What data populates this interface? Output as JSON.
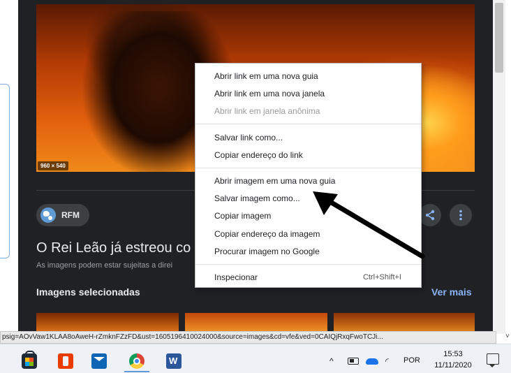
{
  "image_panel": {
    "dimensions_badge": "960 × 540",
    "source_label": "RFM",
    "share_icon": "share-icon",
    "more_icon": "more-vert-icon",
    "result_title": "O Rei Leão já estreou co",
    "result_subtitle": "As imagens podem estar sujeitas a direi",
    "related_section_title": "Imagens selecionadas",
    "see_more_label": "Ver mais"
  },
  "context_menu": {
    "open_link_new_tab": "Abrir link em uma nova guia",
    "open_link_new_window": "Abrir link em uma nova janela",
    "open_link_incognito": "Abrir link em janela anônima",
    "save_link_as": "Salvar link como...",
    "copy_link_address": "Copiar endereço do link",
    "open_image_new_tab": "Abrir imagem em uma nova guia",
    "save_image_as": "Salvar imagem como...",
    "copy_image": "Copiar imagem",
    "copy_image_address": "Copiar endereço da imagem",
    "search_image_google": "Procurar imagem no Google",
    "inspect": "Inspecionar",
    "inspect_shortcut": "Ctrl+Shift+I"
  },
  "status_bar": {
    "url": "psig=AOvVaw1KLAA8oAweH-rZmknFZzFD&ust=1605196410024000&source=images&cd=vfe&ved=0CAIQjRxqFwoTCJi..."
  },
  "taskbar": {
    "apps": [
      "store-icon",
      "office-icon",
      "mail-icon",
      "chrome-icon",
      "word-icon"
    ],
    "tray_chevron": "^",
    "language": "POR",
    "time": "15:53",
    "date": "11/11/2020"
  },
  "colors": {
    "panel_bg": "#202124",
    "link_blue": "#8ab4f8",
    "arrow": "#000000"
  }
}
